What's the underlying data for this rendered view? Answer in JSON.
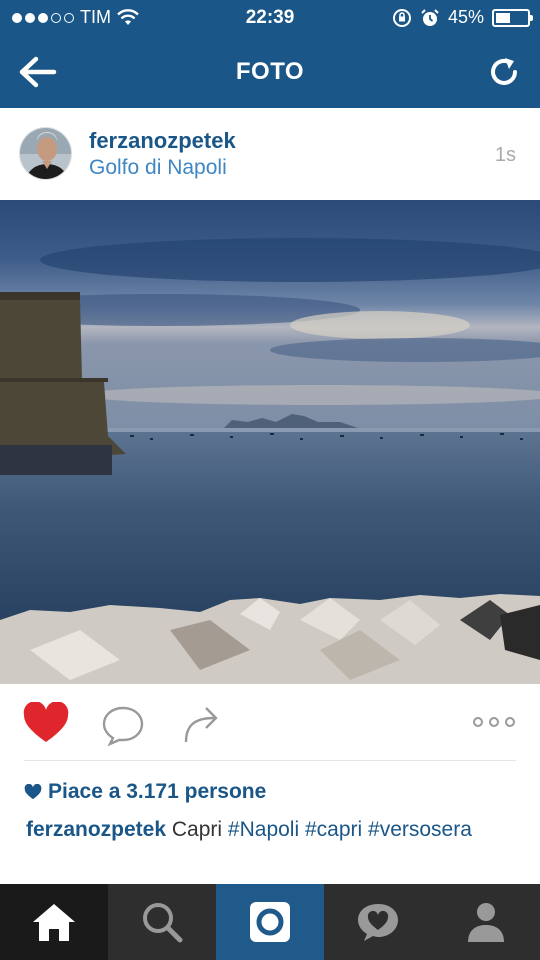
{
  "status_bar": {
    "carrier": "TIM",
    "time": "22:39",
    "battery_percent": "45%",
    "battery_level": 0.45,
    "signal_bars": 3,
    "icons": [
      "wifi-icon",
      "rotation-lock-icon",
      "alarm-icon",
      "battery-icon"
    ]
  },
  "nav": {
    "title": "FOTO",
    "back_icon": "arrow-left-icon",
    "refresh_icon": "refresh-icon"
  },
  "post": {
    "username": "ferzanozpetek",
    "location": "Golfo di Napoli",
    "time_ago": "1s",
    "likes_text": "Piace a 3.171 persone",
    "caption": {
      "username": "ferzanozpetek",
      "text": "Capri",
      "hashtags": [
        "#Napoli",
        "#capri",
        "#versosera"
      ]
    }
  },
  "actions": {
    "like_icon": "heart-icon",
    "liked": true,
    "comment_icon": "comment-icon",
    "share_icon": "share-icon",
    "more_icon": "more-icon"
  },
  "tabbar": [
    "home-icon",
    "search-icon",
    "camera-icon",
    "activity-icon",
    "profile-icon"
  ],
  "colors": {
    "brand_blue": "#1a5687",
    "link_blue": "#3f87c4",
    "like_red": "#e0262d",
    "tabbar_bg": "#2e2e2e"
  }
}
